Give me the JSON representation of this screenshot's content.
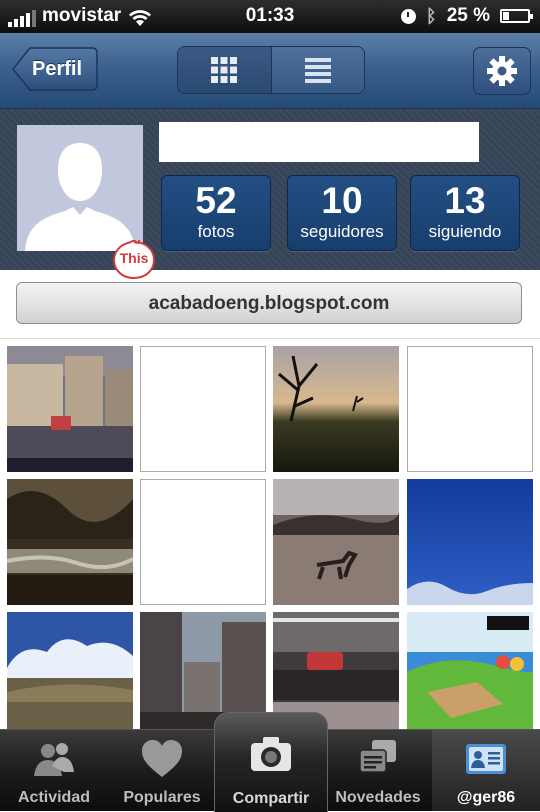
{
  "status_bar": {
    "carrier": "movistar",
    "time": "01:33",
    "battery_percent": "25 %",
    "battery_level": 0.25,
    "signal_bars": 4,
    "icons": [
      "signal-icon",
      "wifi-icon",
      "clock-icon",
      "bluetooth-icon",
      "battery-icon"
    ]
  },
  "nav": {
    "back_label": "Perfil",
    "view_modes": [
      "grid-view-icon",
      "list-view-icon"
    ],
    "selected_view": "grid",
    "settings_icon": "gear-icon"
  },
  "profile": {
    "avatar_icon": "default-avatar-icon",
    "stats": [
      {
        "value": "52",
        "label": "fotos"
      },
      {
        "value": "10",
        "label": "seguidores"
      },
      {
        "value": "13",
        "label": "siguiendo"
      }
    ],
    "badge": "This"
  },
  "website": {
    "url": "acabadoeng.blogspot.com"
  },
  "photos": [
    {
      "kind": "image",
      "subject": "street plaza"
    },
    {
      "kind": "empty"
    },
    {
      "kind": "image",
      "subject": "tree sunset"
    },
    {
      "kind": "empty"
    },
    {
      "kind": "image",
      "subject": "forest stream"
    },
    {
      "kind": "empty"
    },
    {
      "kind": "image",
      "subject": "horse field"
    },
    {
      "kind": "image",
      "subject": "blue sky"
    },
    {
      "kind": "image",
      "subject": "clouds landscape"
    },
    {
      "kind": "image",
      "subject": "city buildings"
    },
    {
      "kind": "image",
      "subject": "metro station"
    },
    {
      "kind": "image",
      "subject": "game screenshot"
    }
  ],
  "tabs": [
    {
      "label": "Actividad",
      "icon": "people-icon"
    },
    {
      "label": "Populares",
      "icon": "heart-icon"
    },
    {
      "label": "Compartir",
      "icon": "camera-icon"
    },
    {
      "label": "Novedades",
      "icon": "news-icon"
    },
    {
      "label": "@ger86",
      "icon": "profile-card-icon",
      "active": true
    }
  ],
  "colors": {
    "nav_blue": "#3c618f",
    "stat_blue": "#1d4576",
    "badge_red": "#d03a3a",
    "tab_active_icon": "#4a8fd8"
  }
}
